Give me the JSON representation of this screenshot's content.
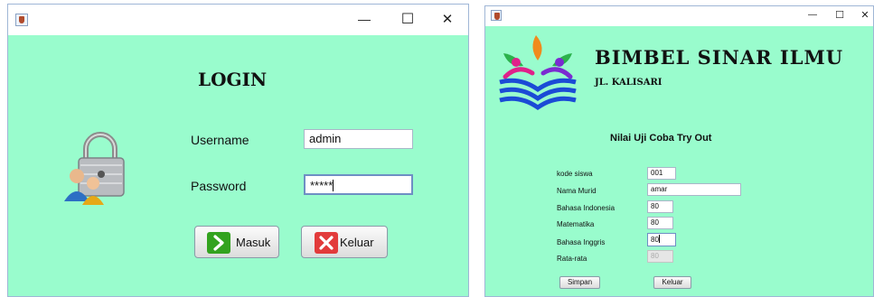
{
  "login_window": {
    "heading": "LOGIN",
    "username_label": "Username",
    "username_value": "admin",
    "password_label": "Password",
    "password_value": "*****",
    "login_button": "Masuk",
    "exit_button": "Keluar",
    "controls": {
      "minimize": "—",
      "maximize": "☐",
      "close": "✕"
    }
  },
  "score_window": {
    "brand_title": "BIMBEL SINAR ILMU",
    "brand_address": "JL. KALISARI",
    "form_title": "Nilai Uji Coba Try Out",
    "fields": [
      {
        "label": "kode siswa",
        "value": "001"
      },
      {
        "label": "Nama Murid",
        "value": "amar"
      },
      {
        "label": "Bahasa Indonesia",
        "value": "80"
      },
      {
        "label": "Matematika",
        "value": "80"
      },
      {
        "label": "Bahasa Inggris",
        "value": "80"
      },
      {
        "label": "Rata-rata",
        "value": "80"
      }
    ],
    "save_button": "Simpan",
    "exit_button": "Keluar",
    "controls": {
      "minimize": "—",
      "maximize": "☐",
      "close": "✕"
    }
  },
  "colors": {
    "panel_background": "#99fccd",
    "exit_icon_red": "#e23b3b",
    "login_icon_green": "#33a31f"
  }
}
